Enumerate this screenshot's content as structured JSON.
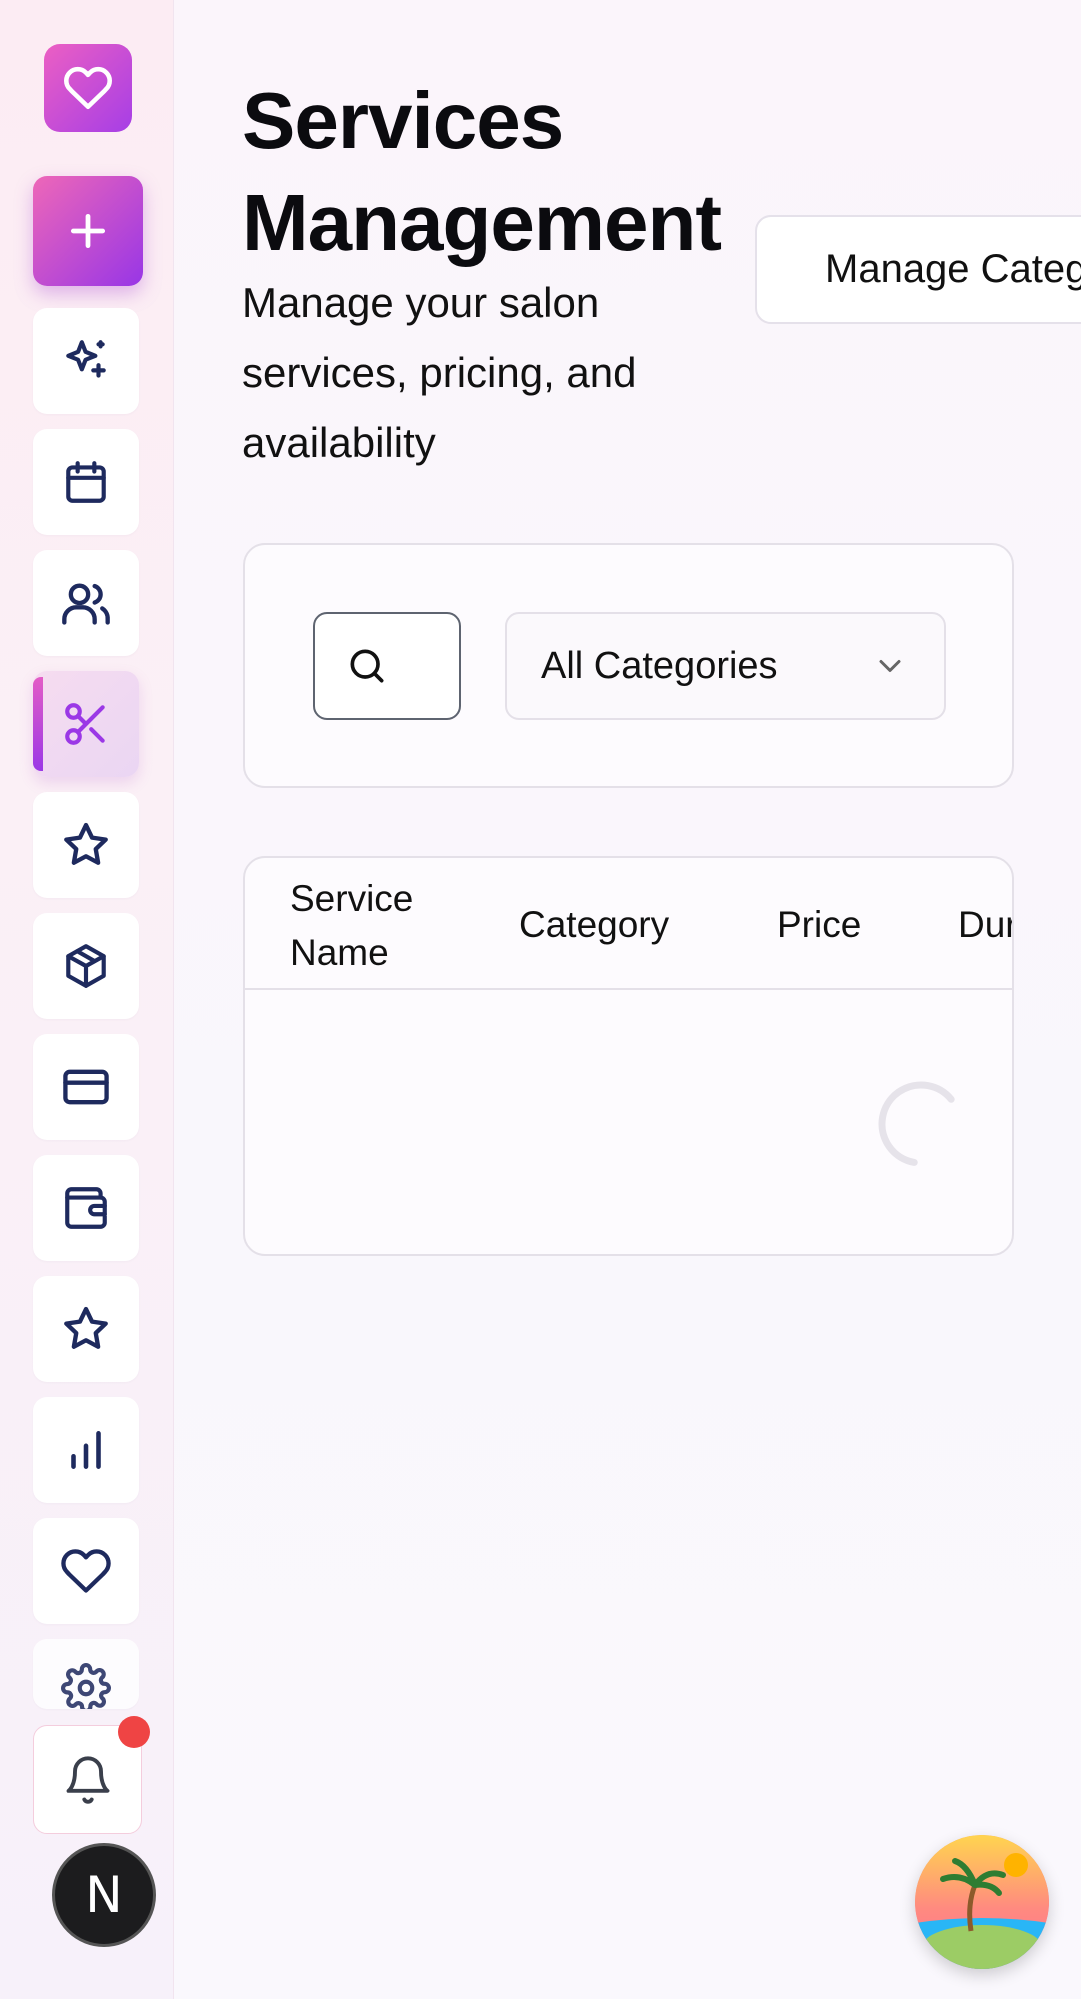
{
  "header": {
    "title": "Services Management",
    "subtitle": "Manage your salon services, pricing, and availability",
    "manage_categories_label": "Manage Categories"
  },
  "filters": {
    "search_placeholder": "",
    "category_selected": "All Categories"
  },
  "table": {
    "columns": [
      "Service Name",
      "Category",
      "Price",
      "Duration"
    ],
    "loading": true
  },
  "sidebar": {
    "logo_icon": "heart-icon",
    "add_icon": "plus-icon",
    "items": [
      {
        "name": "sparkles-icon",
        "active": false
      },
      {
        "name": "calendar-icon",
        "active": false
      },
      {
        "name": "users-icon",
        "active": false
      },
      {
        "name": "scissors-icon",
        "active": true
      },
      {
        "name": "star-icon",
        "active": false
      },
      {
        "name": "package-icon",
        "active": false
      },
      {
        "name": "credit-card-icon",
        "active": false
      },
      {
        "name": "wallet-icon",
        "active": false
      },
      {
        "name": "star-icon",
        "active": false
      },
      {
        "name": "bar-chart-icon",
        "active": false
      },
      {
        "name": "heart-icon",
        "active": false
      },
      {
        "name": "gear-icon",
        "active": false
      }
    ],
    "notification_badge": true,
    "user_initial": "N"
  },
  "colors": {
    "accent_start": "#ec5fc3",
    "accent_end": "#9b38e6",
    "icon_navy": "#1e2a5e",
    "active_icon": "#9b38e6",
    "notification_red": "#ef4444"
  }
}
